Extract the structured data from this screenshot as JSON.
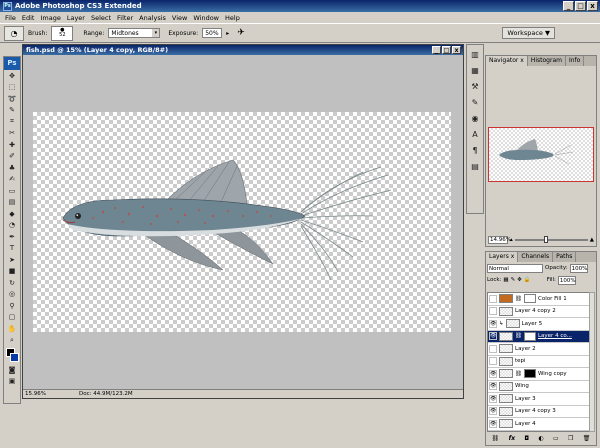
{
  "app": {
    "title": "Adobe Photoshop CS3 Extended",
    "logo": "Ps",
    "min_glyph": "_",
    "max_glyph": "□",
    "close_glyph": "x"
  },
  "menu": [
    "File",
    "Edit",
    "Image",
    "Layer",
    "Select",
    "Filter",
    "Analysis",
    "View",
    "Window",
    "Help"
  ],
  "options": {
    "brush_label": "Brush:",
    "brush_size": "52",
    "range_label": "Range:",
    "range_value": "Midtones",
    "exposure_label": "Exposure:",
    "exposure_value": "50%",
    "workspace_label": "Workspace ▼"
  },
  "document": {
    "title": "fish.psd @ 15% (Layer 4 copy, RGB/8#)",
    "zoom": "15.96%",
    "doc_info": "Doc: 44.9M/123.2M"
  },
  "toolbox": {
    "logo": "Ps",
    "tools": [
      "move-tool",
      "marquee-tool",
      "lasso-tool",
      "quick-selection-tool",
      "crop-tool",
      "slice-tool",
      "healing-tool",
      "brush-tool",
      "clone-stamp-tool",
      "history-brush-tool",
      "eraser-tool",
      "gradient-tool",
      "blur-tool",
      "dodge-tool",
      "pen-tool",
      "type-tool",
      "path-selection-tool",
      "shape-tool",
      "3d-rotate-tool",
      "3d-orbit-tool",
      "eyedropper-tool",
      "note-tool",
      "hand-tool",
      "zoom-tool"
    ]
  },
  "navigator": {
    "tabs": [
      "Navigator",
      "Histogram",
      "Info"
    ],
    "close_glyph": "x",
    "zoom": "14.96%"
  },
  "layers": {
    "tabs": [
      "Layers",
      "Channels",
      "Paths"
    ],
    "close_glyph": "x",
    "blend_mode": "Normal",
    "opacity_label": "Opacity:",
    "opacity": "100%",
    "lock_label": "Lock:",
    "fill_label": "Fill:",
    "fill": "100%",
    "items": [
      {
        "name": "Color Fill 1",
        "visible": false,
        "type": "fill"
      },
      {
        "name": "Layer 4 copy 2",
        "visible": false,
        "type": "normal"
      },
      {
        "name": "Layer 5",
        "visible": true,
        "type": "normal"
      },
      {
        "name": "Layer 4 co...",
        "visible": true,
        "type": "masked",
        "active": true
      },
      {
        "name": "Layer 2",
        "visible": false,
        "type": "normal"
      },
      {
        "name": "tepi",
        "visible": false,
        "type": "normal"
      },
      {
        "name": "Wing copy",
        "visible": true,
        "type": "masked"
      },
      {
        "name": "Wing",
        "visible": true,
        "type": "normal"
      },
      {
        "name": "Layer 3",
        "visible": true,
        "type": "normal"
      },
      {
        "name": "Layer 4 copy 3",
        "visible": true,
        "type": "normal"
      },
      {
        "name": "Layer 4",
        "visible": true,
        "type": "normal"
      }
    ],
    "footer_icons": [
      "link-icon",
      "fx-icon",
      "mask-icon",
      "adjustment-icon",
      "group-icon",
      "new-layer-icon",
      "trash-icon"
    ]
  },
  "colors": {
    "accent": "#0a246a",
    "chrome": "#d4d0c8"
  }
}
